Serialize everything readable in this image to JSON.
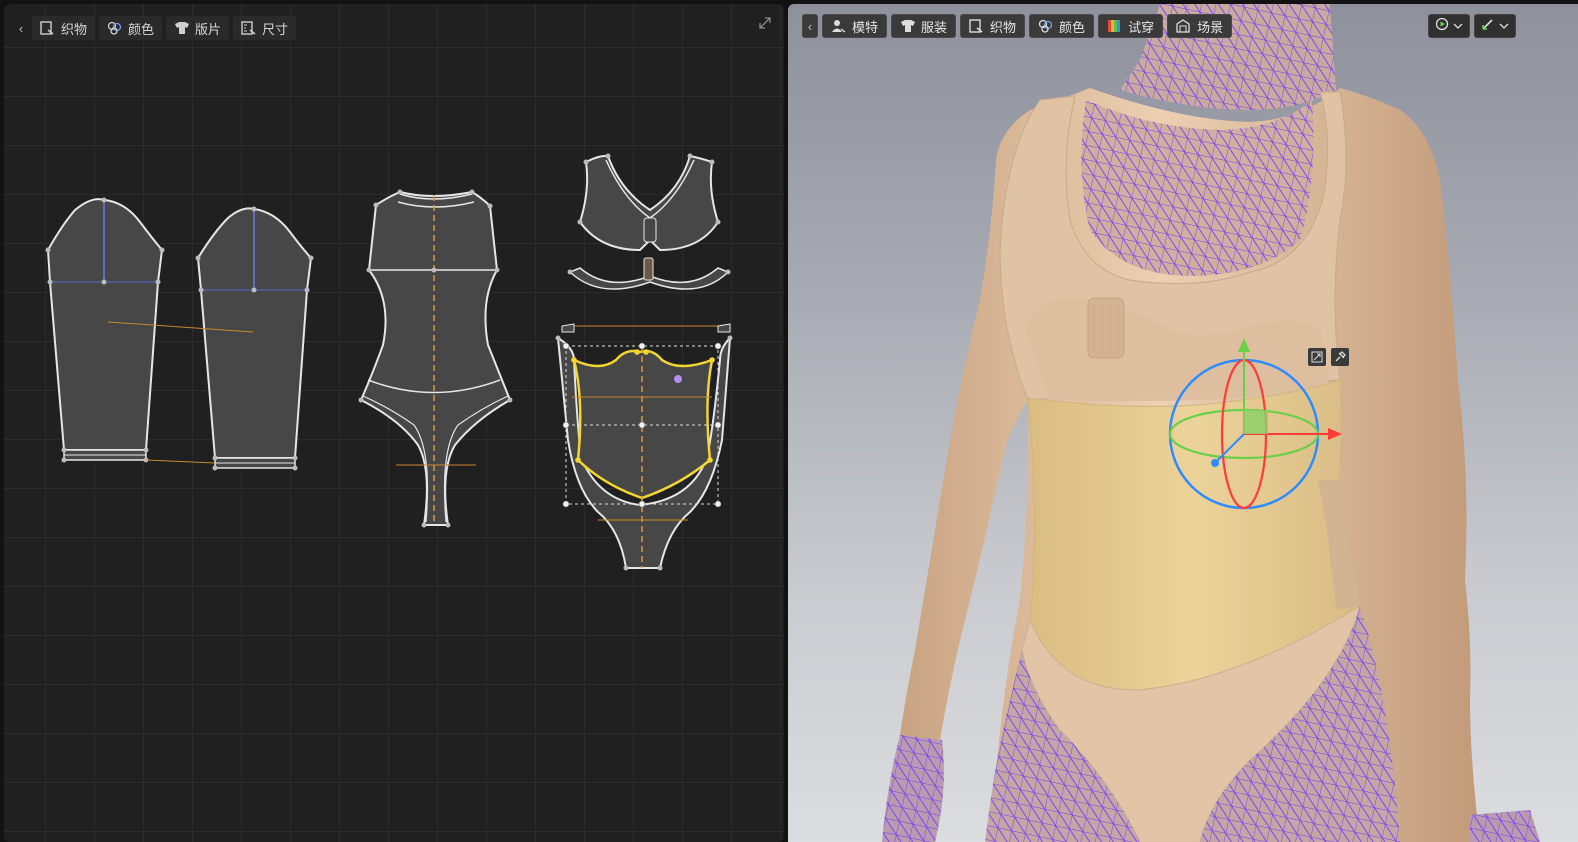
{
  "pattern_toolbar": {
    "back_label": "‹",
    "items": [
      {
        "label": "织物",
        "icon": "fabric-icon"
      },
      {
        "label": "颜色",
        "icon": "color-icon"
      },
      {
        "label": "版片",
        "icon": "pattern-piece-icon"
      },
      {
        "label": "尺寸",
        "icon": "size-icon"
      }
    ]
  },
  "viewport_toolbar": {
    "back_label": "‹",
    "items": [
      {
        "label": "模特",
        "icon": "avatar-icon"
      },
      {
        "label": "服装",
        "icon": "garment-icon"
      },
      {
        "label": "织物",
        "icon": "fabric-icon"
      },
      {
        "label": "颜色",
        "icon": "color-icon"
      },
      {
        "label": "试穿",
        "icon": "fitting-icon"
      },
      {
        "label": "场景",
        "icon": "scene-icon"
      }
    ]
  },
  "colors": {
    "panel_bg": "#202020",
    "pattern_fill": "#474747",
    "pattern_outline": "#e8e8e8",
    "selected_outline": "#f2d630",
    "grain_line": "#d69a3c",
    "skin": "#e2c2a3",
    "garment_selected": "#e8cf94",
    "mesh": "#7a3cf0",
    "gizmo_x": "#ff3b3b",
    "gizmo_y": "#6ad04a",
    "gizmo_z": "#2f8cff"
  }
}
